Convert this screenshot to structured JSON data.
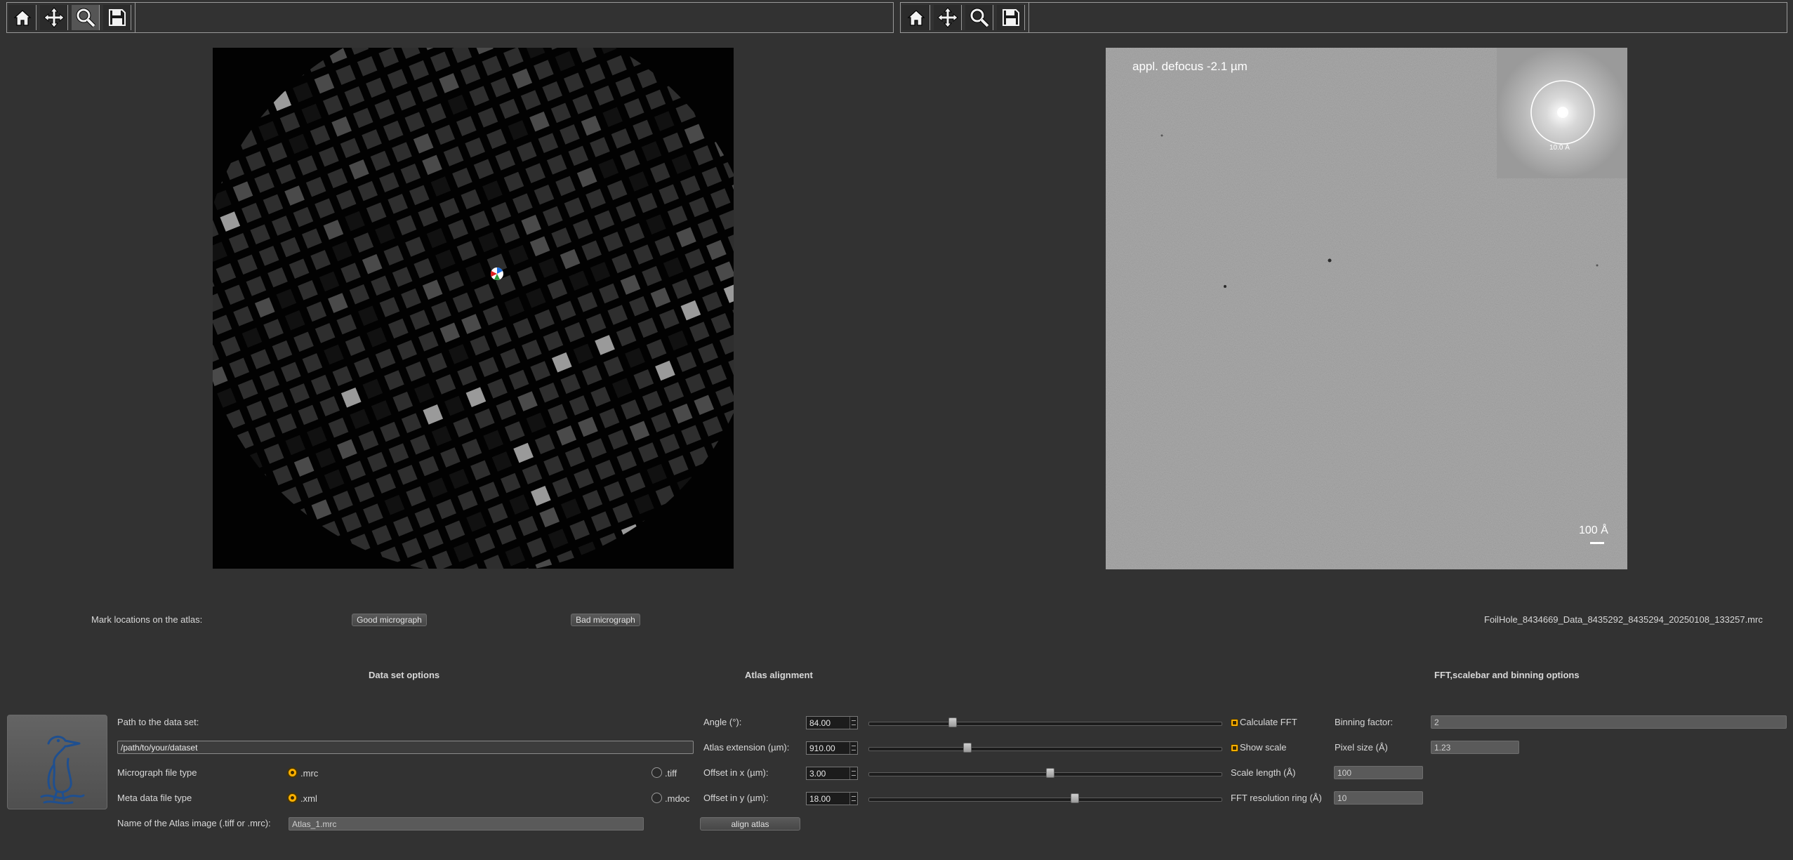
{
  "toolbar_left": {
    "buttons": [
      {
        "icon": "home-icon"
      },
      {
        "icon": "pan-icon"
      },
      {
        "icon": "zoom-icon"
      },
      {
        "icon": "save-icon"
      }
    ]
  },
  "toolbar_right": {
    "buttons": [
      {
        "icon": "home-icon"
      },
      {
        "icon": "pan-icon"
      },
      {
        "icon": "zoom-icon"
      },
      {
        "icon": "save-icon"
      }
    ]
  },
  "micrograph": {
    "defocus_label": "appl. defocus -2.1 µm",
    "fft_ring_label": "10.0 Å",
    "scalebar_label": "100 Å"
  },
  "mark": {
    "label": "Mark locations on the atlas:",
    "good_button": "Good micrograph",
    "bad_button": "Bad micrograph",
    "filename": "FoilHole_8434669_Data_8435292_8435294_20250108_133257.mrc"
  },
  "dataset": {
    "title": "Data set options",
    "path_label": "Path to the data set:",
    "path_value": "/path/to/your/dataset",
    "micrograph_type_label": "Micrograph file type",
    "micrograph_type_options": [
      ".mrc",
      ".tiff"
    ],
    "micrograph_type_selected": ".mrc",
    "metadata_type_label": "Meta data file type",
    "metadata_type_options": [
      ".xml",
      ".mdoc"
    ],
    "metadata_type_selected": ".xml",
    "atlas_name_label": "Name of the Atlas image (.tiff or .mrc):",
    "atlas_name_value": "Atlas_1.mrc"
  },
  "alignment": {
    "title": "Atlas alignment",
    "angle_label": "Angle (°):",
    "angle_value": "84.00",
    "angle_slider_fraction": 0.24,
    "extension_label": "Atlas extension (µm):",
    "extension_value": "910.00",
    "extension_slider_fraction": 0.28,
    "offset_x_label": "Offset in x (µm):",
    "offset_x_value": "3.00",
    "offset_x_slider_fraction": 0.515,
    "offset_y_label": "Offset in y (µm):",
    "offset_y_value": "18.00",
    "offset_y_slider_fraction": 0.585,
    "align_button": "align atlas"
  },
  "fft": {
    "title": "FFT,scalebar and binning options",
    "calculate_fft_label": "Calculate FFT",
    "calculate_fft_checked": true,
    "show_scale_label": "Show scale",
    "show_scale_checked": true,
    "scale_length_label": "Scale length (Å)",
    "scale_length_value": "100",
    "resolution_ring_label": "FFT resolution ring (Å)",
    "resolution_ring_value": "10",
    "binning_label": "Binning factor:",
    "binning_value": "2",
    "pixel_size_label": "Pixel size (Å)",
    "pixel_size_value": "1.23"
  },
  "colors": {
    "background": "#323232",
    "accent": "#ffb000",
    "logo_blue": "#1f4f8f"
  }
}
